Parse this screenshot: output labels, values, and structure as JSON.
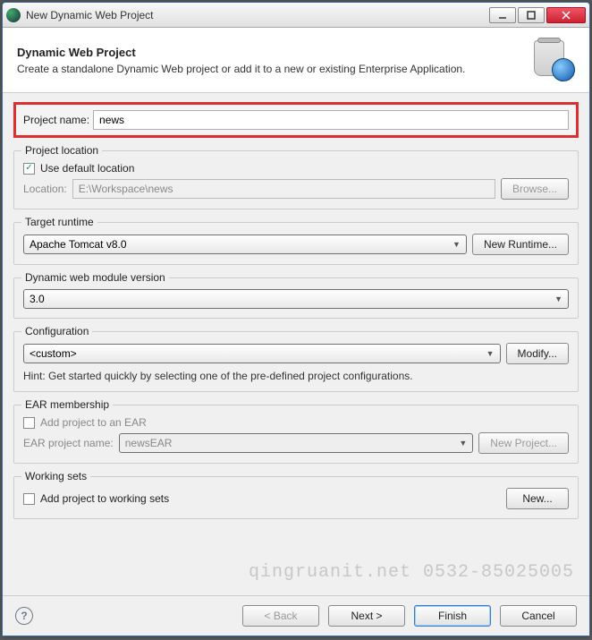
{
  "window": {
    "title": "New Dynamic Web Project"
  },
  "header": {
    "title": "Dynamic Web Project",
    "subtitle": "Create a standalone Dynamic Web project or add it to a new or existing Enterprise Application."
  },
  "project_name": {
    "label": "Project name:",
    "value": "news"
  },
  "location": {
    "group_title": "Project location",
    "use_default_label": "Use default location",
    "use_default_checked": true,
    "location_label": "Location:",
    "location_value": "E:\\Workspace\\news",
    "browse_label": "Browse..."
  },
  "runtime": {
    "group_title": "Target runtime",
    "value": "Apache Tomcat v8.0",
    "new_runtime_label": "New Runtime..."
  },
  "module": {
    "group_title": "Dynamic web module version",
    "value": "3.0"
  },
  "config": {
    "group_title": "Configuration",
    "value": "<custom>",
    "modify_label": "Modify...",
    "hint": "Hint: Get started quickly by selecting one of the pre-defined project configurations."
  },
  "ear": {
    "group_title": "EAR membership",
    "add_label": "Add project to an EAR",
    "add_checked": false,
    "project_name_label": "EAR project name:",
    "project_name_value": "newsEAR",
    "new_project_label": "New Project..."
  },
  "working_sets": {
    "group_title": "Working sets",
    "add_label": "Add project to working sets",
    "add_checked": false,
    "new_label": "New..."
  },
  "footer": {
    "back": "< Back",
    "next": "Next >",
    "finish": "Finish",
    "cancel": "Cancel"
  },
  "watermark": "qingruanit.net 0532-85025005"
}
